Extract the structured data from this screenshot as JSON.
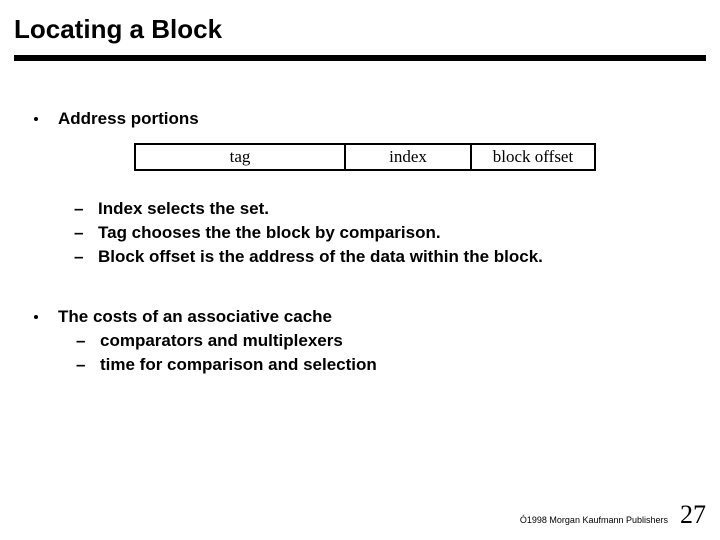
{
  "title": "Locating a Block",
  "bullet1": "Address portions",
  "table": {
    "tag": "tag",
    "index": "index",
    "offset": "block offset"
  },
  "sub1": [
    "Index selects the set.",
    "Tag chooses the the block by comparison.",
    "Block offset is the address of the data within the block."
  ],
  "bullet2": "The costs of an associative cache",
  "sub2": [
    "comparators and multiplexers",
    "time for comparison and selection"
  ],
  "footer": {
    "copyright": "Ó1998 Morgan Kaufmann Publishers",
    "page": "27"
  }
}
